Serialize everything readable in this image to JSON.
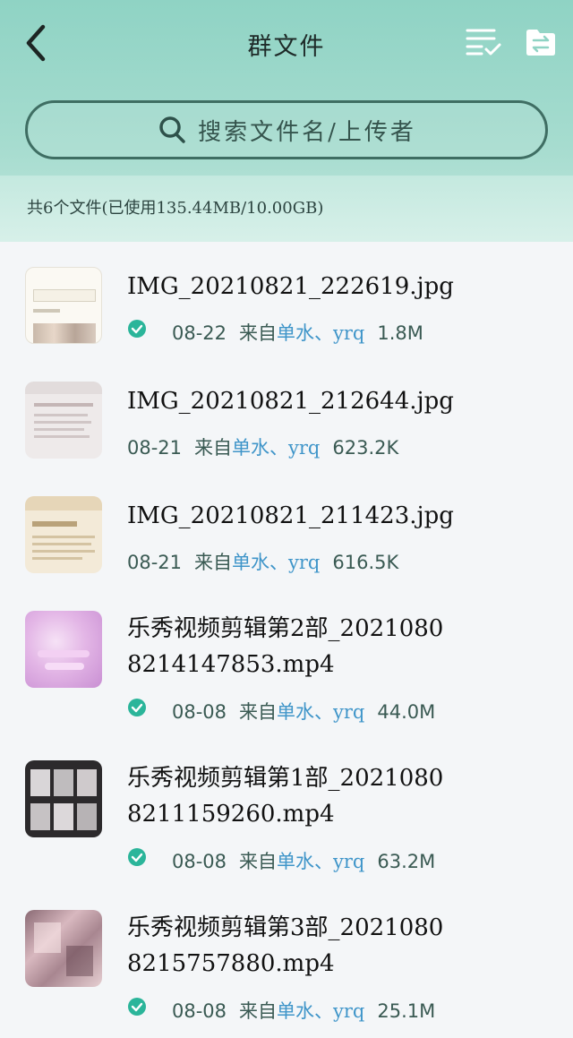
{
  "header": {
    "title": "群文件",
    "search_placeholder": "搜索文件名/上传者",
    "summary": "共6个文件(已使用135.44MB/10.00GB)"
  },
  "colors": {
    "header_top": "#8fd3c4",
    "accent_green": "#2bb59a",
    "link_blue": "#3f95c9"
  },
  "files": [
    {
      "name": "IMG_20210821_222619.jpg",
      "date": "08-22",
      "from": "来自",
      "users": "单水、yrq",
      "size": "1.8M",
      "downloaded": true
    },
    {
      "name": "IMG_20210821_212644.jpg",
      "date": "08-21",
      "from": "来自",
      "users": "单水、yrq",
      "size": "623.2K",
      "downloaded": false
    },
    {
      "name": "IMG_20210821_211423.jpg",
      "date": "08-21",
      "from": "来自",
      "users": "单水、yrq",
      "size": "616.5K",
      "downloaded": false
    },
    {
      "name_line1": "乐秀视频剪辑第2部_2021080",
      "name_line2": "8214147853.mp4",
      "date": "08-08",
      "from": "来自",
      "users": "单水、yrq",
      "size": "44.0M",
      "downloaded": true
    },
    {
      "name_line1": "乐秀视频剪辑第1部_2021080",
      "name_line2": "8211159260.mp4",
      "date": "08-08",
      "from": "来自",
      "users": "单水、yrq",
      "size": "63.2M",
      "downloaded": true
    },
    {
      "name_line1": "乐秀视频剪辑第3部_2021080",
      "name_line2": "8215757880.mp4",
      "date": "08-08",
      "from": "来自",
      "users": "单水、yrq",
      "size": "25.1M",
      "downloaded": true
    }
  ]
}
